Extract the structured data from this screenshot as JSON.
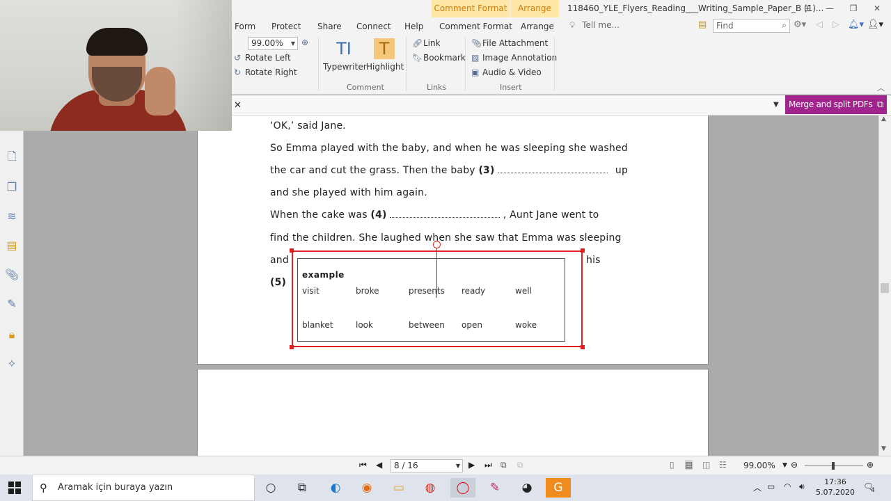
{
  "window": {
    "title": "118460_YLE_Flyers_Reading___Writing_Sample_Paper_B (1)...",
    "context_tabs": [
      "Comment Format",
      "Arrange"
    ]
  },
  "ribbon": {
    "tabs": [
      "Form",
      "Protect",
      "Share",
      "Connect",
      "Help",
      "Comment Format",
      "Arrange"
    ],
    "tell_me": "Tell me...",
    "find_placeholder": "Find",
    "zoom_value": "99.00%",
    "rotate_left": "Rotate Left",
    "rotate_right": "Rotate Right",
    "typewriter": "Typewriter",
    "highlight": "Highlight",
    "link": "Link",
    "bookmark": "Bookmark",
    "file_attachment": "File Attachment",
    "image_annotation": "Image Annotation",
    "audio_video": "Audio & Video",
    "groups": {
      "comment": "Comment",
      "links": "Links",
      "insert": "Insert"
    }
  },
  "docbar": {
    "merge_label": "Merge and split PDFs"
  },
  "document": {
    "lines": [
      "‘OK,’ said Jane.",
      "So Emma played with the baby, and when he was sleeping she washed",
      "the car and cut the grass. Then the baby",
      "and she played with him again.",
      "When the cake was",
      "find the children. She laughed when she saw that Emma was sleeping",
      "and",
      "his"
    ],
    "gap3_num": "(3)",
    "gap3_after": "up",
    "gap4_num": "(4)",
    "gap4_after": ", Aunt Jane went to",
    "gap5_num": "(5)",
    "wordbox": {
      "title": "example",
      "row1": [
        "visit",
        "broke",
        "presents",
        "ready",
        "well"
      ],
      "row2": [
        "blanket",
        "look",
        "between",
        "open",
        "woke"
      ]
    }
  },
  "statusbar": {
    "page": "8 / 16",
    "zoom": "99.00%"
  },
  "taskbar": {
    "search_placeholder": "Aramak için buraya yazın",
    "time": "17:36",
    "date": "5.07.2020",
    "notification_count": "4"
  },
  "colors": {
    "accent": "#a1238d",
    "context_tab": "#ffe7a8",
    "selection": "#e02020"
  }
}
